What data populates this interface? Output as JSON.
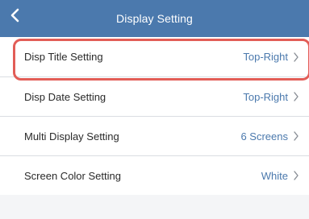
{
  "header": {
    "title": "Display Setting"
  },
  "rows": [
    {
      "label": "Disp Title Setting",
      "value": "Top-Right"
    },
    {
      "label": "Disp Date Setting",
      "value": "Top-Right"
    },
    {
      "label": "Multi Display Setting",
      "value": "6 Screens"
    },
    {
      "label": "Screen Color Setting",
      "value": "White"
    }
  ],
  "colors": {
    "header_bg": "#4b79ad",
    "value_text": "#4b79ad",
    "highlight": "#e25d57",
    "background": "#f4f5f7"
  },
  "icons": {
    "back": "chevron-left-icon",
    "row_chevron": "chevron-right-icon"
  }
}
